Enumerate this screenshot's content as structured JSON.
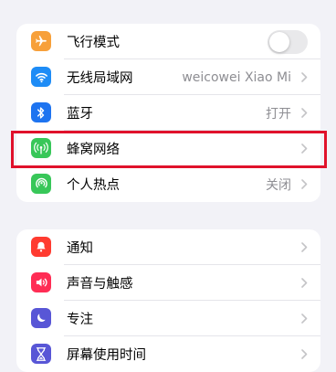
{
  "colors": {
    "airplane": "#f7a03a",
    "wifi": "#1e8cf6",
    "bluetooth": "#1e74f0",
    "cellular": "#38c759",
    "hotspot": "#38c759",
    "notifications": "#ff3b30",
    "sounds": "#ff2d55",
    "focus": "#5856d6",
    "screentime": "#5856d6",
    "highlight": "#e0112b"
  },
  "group1": {
    "items": [
      {
        "icon": "airplane-icon",
        "label": "飞行模式",
        "toggle_on": false
      },
      {
        "icon": "wifi-icon",
        "label": "无线局域网",
        "value": "weicowei Xiao Mi"
      },
      {
        "icon": "bluetooth-icon",
        "label": "蓝牙",
        "value": "打开"
      },
      {
        "icon": "antenna-icon",
        "label": "蜂窝网络"
      },
      {
        "icon": "hotspot-icon",
        "label": "个人热点",
        "value": "关闭"
      }
    ]
  },
  "group2": {
    "items": [
      {
        "icon": "bell-icon",
        "label": "通知"
      },
      {
        "icon": "speaker-icon",
        "label": "声音与触感"
      },
      {
        "icon": "moon-icon",
        "label": "专注"
      },
      {
        "icon": "hourglass-icon",
        "label": "屏幕使用时间"
      }
    ]
  }
}
